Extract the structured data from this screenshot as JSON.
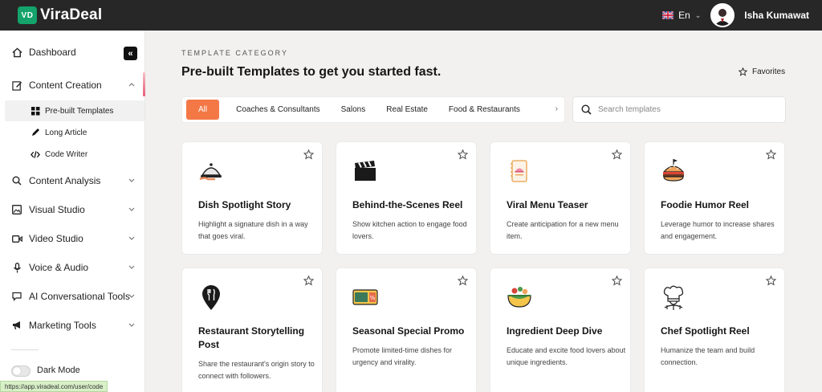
{
  "app": {
    "badge": "VD",
    "name": "ViraDeal"
  },
  "topbar": {
    "language": "En",
    "user_name": "Isha Kumawat"
  },
  "sidebar": {
    "dashboard": "Dashboard",
    "content_creation": "Content Creation",
    "sub_items": [
      "Pre-built Templates",
      "Long Article",
      "Code Writer"
    ],
    "items": [
      "Content Analysis",
      "Visual Studio",
      "Video Studio",
      "Voice & Audio",
      "AI Conversational Tools",
      "Marketing Tools"
    ],
    "dark_mode": "Dark Mode"
  },
  "status_url": "https://app.viradeal.com/user/code",
  "main": {
    "kicker": "TEMPLATE CATEGORY",
    "title": "Pre-built Templates to get you started fast.",
    "favorites": "Favorites",
    "categories": [
      "All",
      "Coaches & Consultants",
      "Salons",
      "Real Estate",
      "Food & Restaurants"
    ],
    "search_placeholder": "Search templates"
  },
  "cards": [
    {
      "title": "Dish Spotlight Story",
      "desc": "Highlight a signature dish in a way that goes viral.",
      "icon": "cloche-icon"
    },
    {
      "title": "Behind-the-Scenes Reel",
      "desc": "Show kitchen action to engage food lovers.",
      "icon": "clapperboard-icon"
    },
    {
      "title": "Viral Menu Teaser",
      "desc": "Create anticipation for a new menu item.",
      "icon": "menu-book-icon"
    },
    {
      "title": "Foodie Humor Reel",
      "desc": "Leverage humor to increase shares and engagement.",
      "icon": "burger-icon"
    },
    {
      "title": "Restaurant Storytelling Post",
      "desc": "Share the restaurant's origin story to connect with followers.",
      "icon": "restaurant-pin-icon"
    },
    {
      "title": "Seasonal Special Promo",
      "desc": "Promote limited-time dishes for urgency and virality.",
      "icon": "coupon-icon"
    },
    {
      "title": "Ingredient Deep Dive",
      "desc": "Educate and excite food lovers about unique ingredients.",
      "icon": "salad-bowl-icon"
    },
    {
      "title": "Chef Spotlight Reel",
      "desc": "Humanize the team and build connection.",
      "icon": "chef-hat-icon"
    }
  ],
  "colors": {
    "accent": "#f37846",
    "brand": "#13a36b",
    "topbar": "#272727"
  }
}
